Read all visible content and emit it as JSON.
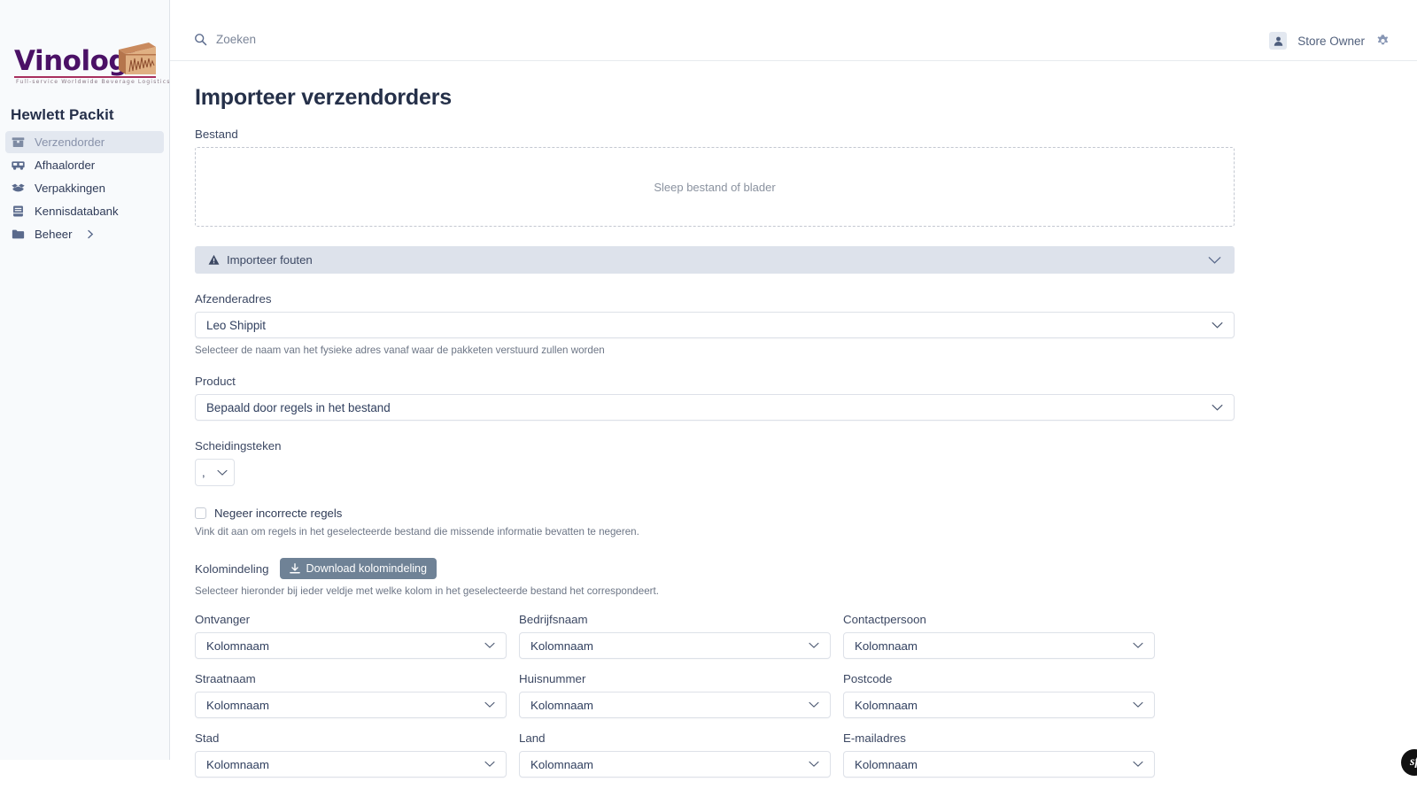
{
  "sidebar": {
    "logo": {
      "wordmark": "Vinologix",
      "tagline": "Full-service Worldwide Beverage Logistics"
    },
    "brand": "Hewlett Packit",
    "items": [
      {
        "label": "Verzendorder",
        "icon": "box-icon",
        "active": true
      },
      {
        "label": "Afhaalorder",
        "icon": "truck-icon",
        "active": false
      },
      {
        "label": "Verpakkingen",
        "icon": "open-box-icon",
        "active": false
      },
      {
        "label": "Kennisdatabank",
        "icon": "book-icon",
        "active": false
      },
      {
        "label": "Beheer",
        "icon": "folder-icon",
        "active": false,
        "has_caret": true
      }
    ]
  },
  "topbar": {
    "search_text": "Zoeken",
    "user_name": "Store Owner"
  },
  "main": {
    "page_title": "Importeer verzendorders",
    "file": {
      "label": "Bestand",
      "dropzone_text": "Sleep bestand of blader"
    },
    "error_banner": {
      "label": "Importeer fouten"
    },
    "sender_address": {
      "label": "Afzenderadres",
      "value": "Leo Shippit",
      "helper": "Selecteer de naam van het fysieke adres vanaf waar de pakketen verstuurd zullen worden"
    },
    "product": {
      "label": "Product",
      "value": "Bepaald door regels in het bestand"
    },
    "separator": {
      "label": "Scheidingsteken",
      "value": ","
    },
    "ignore_invalid": {
      "label": "Negeer incorrecte regels",
      "helper": "Vink dit aan om regels in het geselecteerde bestand die missende informatie bevatten te negeren.",
      "checked": false
    },
    "column_mapping": {
      "label": "Kolomindeling",
      "download_button": "Download kolomindeling",
      "helper": "Selecteer hieronder bij ieder veldje met welke kolom in het geselecteerde bestand het correspondeert.",
      "fields": [
        {
          "label": "Ontvanger",
          "value": "Kolomnaam"
        },
        {
          "label": "Bedrijfsnaam",
          "value": "Kolomnaam"
        },
        {
          "label": "Contactpersoon",
          "value": "Kolomnaam"
        },
        {
          "label": "Straatnaam",
          "value": "Kolomnaam"
        },
        {
          "label": "Huisnummer",
          "value": "Kolomnaam"
        },
        {
          "label": "Postcode",
          "value": "Kolomnaam"
        },
        {
          "label": "Stad",
          "value": "Kolomnaam"
        },
        {
          "label": "Land",
          "value": "Kolomnaam"
        },
        {
          "label": "E-mailadres",
          "value": "Kolomnaam"
        }
      ]
    }
  },
  "badge": {
    "text": "sf"
  },
  "colors": {
    "accent_purple": "#4b1166",
    "accent_red": "#a8305e",
    "nav_active_bg": "#e3e8f0",
    "banner_bg": "#dde2eb",
    "button_slate": "#6f8296",
    "text_dark": "#253049"
  }
}
